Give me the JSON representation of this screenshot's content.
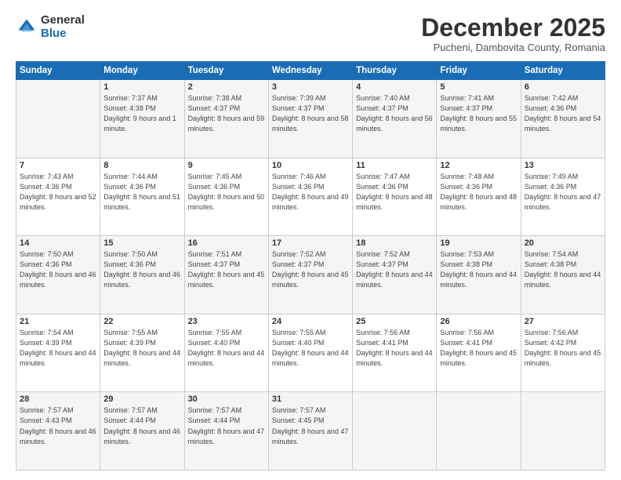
{
  "logo": {
    "general": "General",
    "blue": "Blue"
  },
  "title": "December 2025",
  "subtitle": "Pucheni, Dambovita County, Romania",
  "header_days": [
    "Sunday",
    "Monday",
    "Tuesday",
    "Wednesday",
    "Thursday",
    "Friday",
    "Saturday"
  ],
  "weeks": [
    [
      {
        "day": "",
        "sunrise": "",
        "sunset": "",
        "daylight": ""
      },
      {
        "day": "1",
        "sunrise": "Sunrise: 7:37 AM",
        "sunset": "Sunset: 4:38 PM",
        "daylight": "Daylight: 9 hours and 1 minute."
      },
      {
        "day": "2",
        "sunrise": "Sunrise: 7:38 AM",
        "sunset": "Sunset: 4:37 PM",
        "daylight": "Daylight: 8 hours and 59 minutes."
      },
      {
        "day": "3",
        "sunrise": "Sunrise: 7:39 AM",
        "sunset": "Sunset: 4:37 PM",
        "daylight": "Daylight: 8 hours and 58 minutes."
      },
      {
        "day": "4",
        "sunrise": "Sunrise: 7:40 AM",
        "sunset": "Sunset: 4:37 PM",
        "daylight": "Daylight: 8 hours and 56 minutes."
      },
      {
        "day": "5",
        "sunrise": "Sunrise: 7:41 AM",
        "sunset": "Sunset: 4:37 PM",
        "daylight": "Daylight: 8 hours and 55 minutes."
      },
      {
        "day": "6",
        "sunrise": "Sunrise: 7:42 AM",
        "sunset": "Sunset: 4:36 PM",
        "daylight": "Daylight: 8 hours and 54 minutes."
      }
    ],
    [
      {
        "day": "7",
        "sunrise": "Sunrise: 7:43 AM",
        "sunset": "Sunset: 4:36 PM",
        "daylight": "Daylight: 8 hours and 52 minutes."
      },
      {
        "day": "8",
        "sunrise": "Sunrise: 7:44 AM",
        "sunset": "Sunset: 4:36 PM",
        "daylight": "Daylight: 8 hours and 51 minutes."
      },
      {
        "day": "9",
        "sunrise": "Sunrise: 7:45 AM",
        "sunset": "Sunset: 4:36 PM",
        "daylight": "Daylight: 8 hours and 50 minutes."
      },
      {
        "day": "10",
        "sunrise": "Sunrise: 7:46 AM",
        "sunset": "Sunset: 4:36 PM",
        "daylight": "Daylight: 8 hours and 49 minutes."
      },
      {
        "day": "11",
        "sunrise": "Sunrise: 7:47 AM",
        "sunset": "Sunset: 4:36 PM",
        "daylight": "Daylight: 8 hours and 48 minutes."
      },
      {
        "day": "12",
        "sunrise": "Sunrise: 7:48 AM",
        "sunset": "Sunset: 4:36 PM",
        "daylight": "Daylight: 8 hours and 48 minutes."
      },
      {
        "day": "13",
        "sunrise": "Sunrise: 7:49 AM",
        "sunset": "Sunset: 4:36 PM",
        "daylight": "Daylight: 8 hours and 47 minutes."
      }
    ],
    [
      {
        "day": "14",
        "sunrise": "Sunrise: 7:50 AM",
        "sunset": "Sunset: 4:36 PM",
        "daylight": "Daylight: 8 hours and 46 minutes."
      },
      {
        "day": "15",
        "sunrise": "Sunrise: 7:50 AM",
        "sunset": "Sunset: 4:36 PM",
        "daylight": "Daylight: 8 hours and 46 minutes."
      },
      {
        "day": "16",
        "sunrise": "Sunrise: 7:51 AM",
        "sunset": "Sunset: 4:37 PM",
        "daylight": "Daylight: 8 hours and 45 minutes."
      },
      {
        "day": "17",
        "sunrise": "Sunrise: 7:52 AM",
        "sunset": "Sunset: 4:37 PM",
        "daylight": "Daylight: 8 hours and 45 minutes."
      },
      {
        "day": "18",
        "sunrise": "Sunrise: 7:52 AM",
        "sunset": "Sunset: 4:37 PM",
        "daylight": "Daylight: 8 hours and 44 minutes."
      },
      {
        "day": "19",
        "sunrise": "Sunrise: 7:53 AM",
        "sunset": "Sunset: 4:38 PM",
        "daylight": "Daylight: 8 hours and 44 minutes."
      },
      {
        "day": "20",
        "sunrise": "Sunrise: 7:54 AM",
        "sunset": "Sunset: 4:38 PM",
        "daylight": "Daylight: 8 hours and 44 minutes."
      }
    ],
    [
      {
        "day": "21",
        "sunrise": "Sunrise: 7:54 AM",
        "sunset": "Sunset: 4:39 PM",
        "daylight": "Daylight: 8 hours and 44 minutes."
      },
      {
        "day": "22",
        "sunrise": "Sunrise: 7:55 AM",
        "sunset": "Sunset: 4:39 PM",
        "daylight": "Daylight: 8 hours and 44 minutes."
      },
      {
        "day": "23",
        "sunrise": "Sunrise: 7:55 AM",
        "sunset": "Sunset: 4:40 PM",
        "daylight": "Daylight: 8 hours and 44 minutes."
      },
      {
        "day": "24",
        "sunrise": "Sunrise: 7:55 AM",
        "sunset": "Sunset: 4:40 PM",
        "daylight": "Daylight: 8 hours and 44 minutes."
      },
      {
        "day": "25",
        "sunrise": "Sunrise: 7:56 AM",
        "sunset": "Sunset: 4:41 PM",
        "daylight": "Daylight: 8 hours and 44 minutes."
      },
      {
        "day": "26",
        "sunrise": "Sunrise: 7:56 AM",
        "sunset": "Sunset: 4:41 PM",
        "daylight": "Daylight: 8 hours and 45 minutes."
      },
      {
        "day": "27",
        "sunrise": "Sunrise: 7:56 AM",
        "sunset": "Sunset: 4:42 PM",
        "daylight": "Daylight: 8 hours and 45 minutes."
      }
    ],
    [
      {
        "day": "28",
        "sunrise": "Sunrise: 7:57 AM",
        "sunset": "Sunset: 4:43 PM",
        "daylight": "Daylight: 8 hours and 46 minutes."
      },
      {
        "day": "29",
        "sunrise": "Sunrise: 7:57 AM",
        "sunset": "Sunset: 4:44 PM",
        "daylight": "Daylight: 8 hours and 46 minutes."
      },
      {
        "day": "30",
        "sunrise": "Sunrise: 7:57 AM",
        "sunset": "Sunset: 4:44 PM",
        "daylight": "Daylight: 8 hours and 47 minutes."
      },
      {
        "day": "31",
        "sunrise": "Sunrise: 7:57 AM",
        "sunset": "Sunset: 4:45 PM",
        "daylight": "Daylight: 8 hours and 47 minutes."
      },
      {
        "day": "",
        "sunrise": "",
        "sunset": "",
        "daylight": ""
      },
      {
        "day": "",
        "sunrise": "",
        "sunset": "",
        "daylight": ""
      },
      {
        "day": "",
        "sunrise": "",
        "sunset": "",
        "daylight": ""
      }
    ]
  ]
}
